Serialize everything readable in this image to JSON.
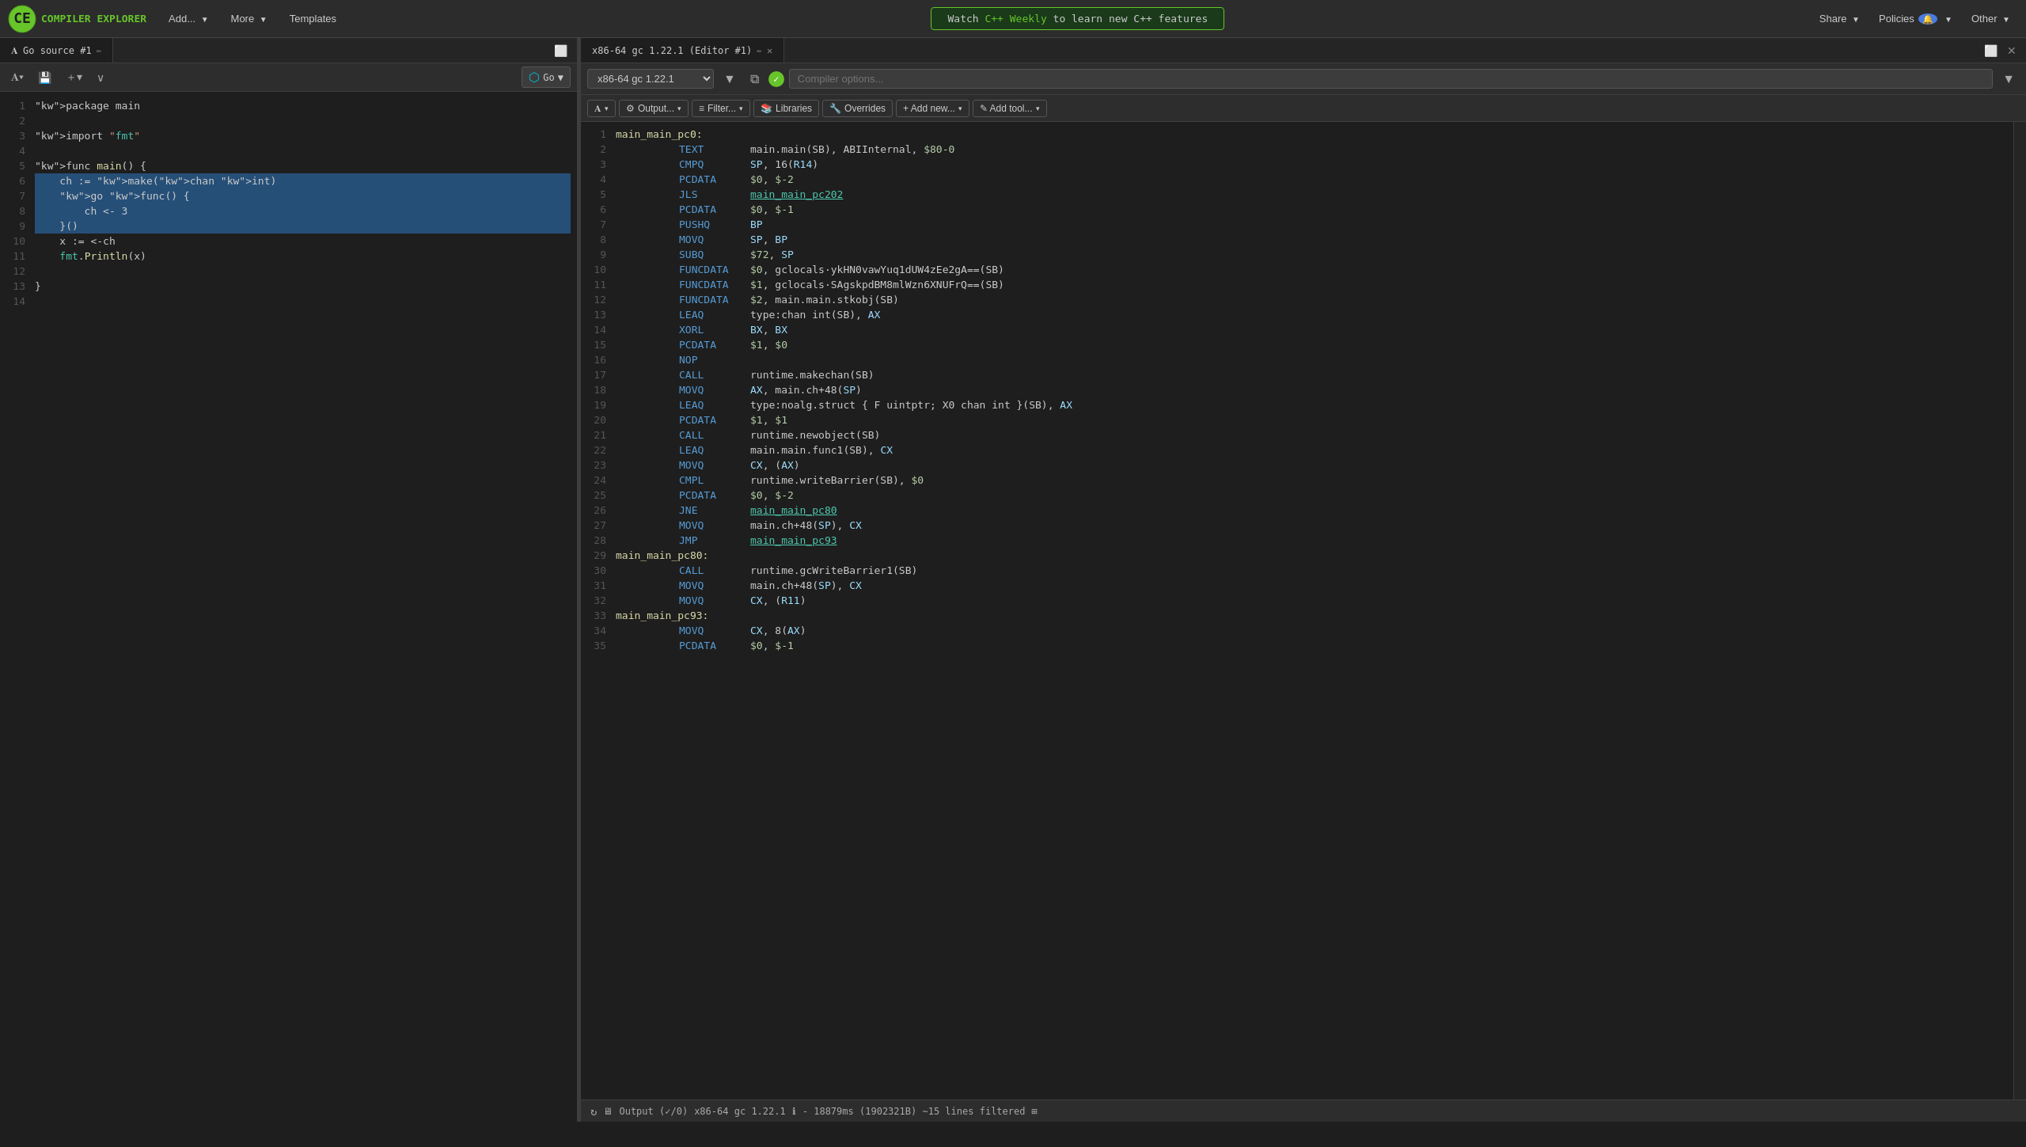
{
  "app": {
    "title": "COMPILER EXPLORER"
  },
  "nav": {
    "add_label": "Add...",
    "more_label": "More",
    "templates_label": "Templates",
    "share_label": "Share",
    "policies_label": "Policies",
    "other_label": "Other",
    "banner_text": "Watch C++ Weekly to learn new C++ features",
    "banner_link": "C++ Weekly"
  },
  "source_tab": {
    "title": "Go source #1",
    "lang": "Go"
  },
  "asm_tab": {
    "title": "x86-64 gc 1.22.1 (Editor #1)"
  },
  "compiler": {
    "name": "x86-64 gc 1.22.1",
    "options_placeholder": "Compiler options..."
  },
  "toolbar": {
    "output_label": "Output...",
    "filter_label": "Filter...",
    "libraries_label": "Libraries",
    "overrides_label": "Overrides",
    "add_new_label": "+ Add new...",
    "add_tool_label": "✎ Add tool..."
  },
  "source_code": {
    "lines": [
      {
        "num": 1,
        "text": "package main",
        "selected": false
      },
      {
        "num": 2,
        "text": "",
        "selected": false
      },
      {
        "num": 3,
        "text": "import \"fmt\"",
        "selected": false
      },
      {
        "num": 4,
        "text": "",
        "selected": false
      },
      {
        "num": 5,
        "text": "func main() {",
        "selected": false
      },
      {
        "num": 6,
        "text": "    ch := make(chan int)",
        "selected": true
      },
      {
        "num": 7,
        "text": "    go func() {",
        "selected": true
      },
      {
        "num": 8,
        "text": "        ch <- 3",
        "selected": true
      },
      {
        "num": 9,
        "text": "    }()",
        "selected": true
      },
      {
        "num": 10,
        "text": "    x := <-ch",
        "selected": false
      },
      {
        "num": 11,
        "text": "    fmt.Println(x)",
        "selected": false
      },
      {
        "num": 12,
        "text": "",
        "selected": false
      },
      {
        "num": 13,
        "text": "}",
        "selected": false
      },
      {
        "num": 14,
        "text": "",
        "selected": false
      }
    ]
  },
  "asm_code": {
    "lines": [
      {
        "num": 1,
        "content": "main_main_pc0:",
        "type": "label"
      },
      {
        "num": 2,
        "instr": "TEXT",
        "operands": "main.main(SB), ABIInternal, $80-0"
      },
      {
        "num": 3,
        "instr": "CMPQ",
        "operands": "SP, 16(R14)"
      },
      {
        "num": 4,
        "instr": "PCDATA",
        "operands": "$0, $-2"
      },
      {
        "num": 5,
        "instr": "JLS",
        "operands": "main_main_pc202",
        "link": true
      },
      {
        "num": 6,
        "instr": "PCDATA",
        "operands": "$0, $-1"
      },
      {
        "num": 7,
        "instr": "PUSHQ",
        "operands": "BP"
      },
      {
        "num": 8,
        "instr": "MOVQ",
        "operands": "SP, BP"
      },
      {
        "num": 9,
        "instr": "SUBQ",
        "operands": "$72, SP"
      },
      {
        "num": 10,
        "instr": "FUNCDATA",
        "operands": "$0, gclocals·ykHN0vawYuq1dUW4zEe2gA==(SB)"
      },
      {
        "num": 11,
        "instr": "FUNCDATA",
        "operands": "$1, gclocals·SAgskpdBM8mlWzn6XNUFrQ==(SB)"
      },
      {
        "num": 12,
        "instr": "FUNCDATA",
        "operands": "$2, main.main.stkobj(SB)"
      },
      {
        "num": 13,
        "instr": "LEAQ",
        "operands": "type:chan int(SB), AX"
      },
      {
        "num": 14,
        "instr": "XORL",
        "operands": "BX, BX"
      },
      {
        "num": 15,
        "instr": "PCDATA",
        "operands": "$1, $0"
      },
      {
        "num": 16,
        "instr": "NOP",
        "operands": ""
      },
      {
        "num": 17,
        "instr": "CALL",
        "operands": "runtime.makechan(SB)"
      },
      {
        "num": 18,
        "instr": "MOVQ",
        "operands": "AX, main.ch+48(SP)"
      },
      {
        "num": 19,
        "instr": "LEAQ",
        "operands": "type:noalg.struct { F uintptr; X0 chan int }(SB), AX"
      },
      {
        "num": 20,
        "instr": "PCDATA",
        "operands": "$1, $1"
      },
      {
        "num": 21,
        "instr": "CALL",
        "operands": "runtime.newobject(SB)"
      },
      {
        "num": 22,
        "instr": "LEAQ",
        "operands": "main.main.func1(SB), CX"
      },
      {
        "num": 23,
        "instr": "MOVQ",
        "operands": "CX, (AX)"
      },
      {
        "num": 24,
        "instr": "CMPL",
        "operands": "runtime.writeBarrier(SB), $0"
      },
      {
        "num": 25,
        "instr": "PCDATA",
        "operands": "$0, $-2"
      },
      {
        "num": 26,
        "instr": "JNE",
        "operands": "main_main_pc80",
        "link": true
      },
      {
        "num": 27,
        "instr": "MOVQ",
        "operands": "main.ch+48(SP), CX"
      },
      {
        "num": 28,
        "instr": "JMP",
        "operands": "main_main_pc93",
        "link": true
      },
      {
        "num": 29,
        "content": "main_main_pc80:",
        "type": "label"
      },
      {
        "num": 30,
        "instr": "CALL",
        "operands": "runtime.gcWriteBarrier1(SB)"
      },
      {
        "num": 31,
        "instr": "MOVQ",
        "operands": "main.ch+48(SP), CX"
      },
      {
        "num": 32,
        "instr": "MOVQ",
        "operands": "CX, (R11)"
      },
      {
        "num": 33,
        "content": "main_main_pc93:",
        "type": "label"
      },
      {
        "num": 34,
        "instr": "MOVQ",
        "operands": "CX, 8(AX)"
      },
      {
        "num": 35,
        "instr": "PCDATA",
        "operands": "$0, $-1"
      }
    ]
  },
  "status_bar": {
    "output_label": "Output (✓/0)",
    "compiler_name": "x86-64 gc 1.22.1",
    "info_text": "- 18879ms (1902321B) ~15 lines filtered"
  },
  "colors": {
    "accent": "#67c52a",
    "selected_line": "#264f78",
    "link": "#4ec9b0"
  }
}
